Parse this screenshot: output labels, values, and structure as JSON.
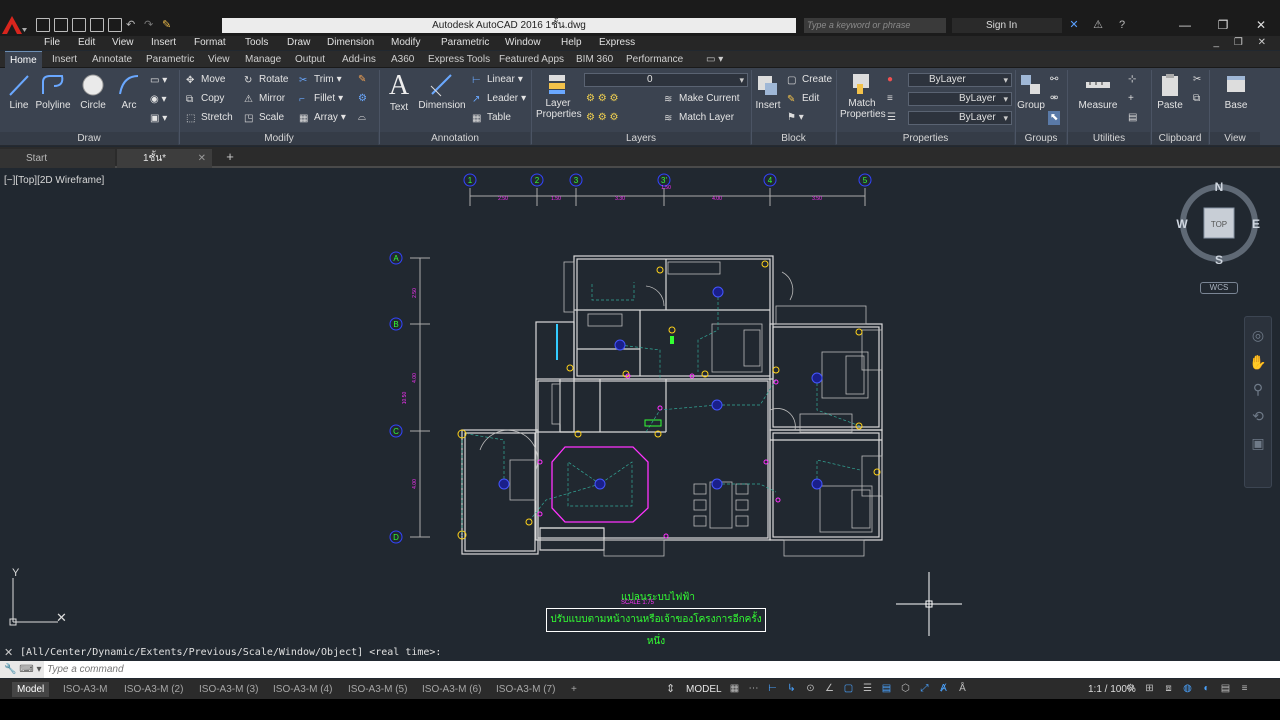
{
  "titlebar": {
    "title": "Autodesk AutoCAD 2016    1ชั้น.dwg",
    "search_placeholder": "Type a keyword or phrase",
    "signin_label": "Sign In",
    "logo_color": "#d8251d"
  },
  "menu": [
    "File",
    "Edit",
    "View",
    "Insert",
    "Format",
    "Tools",
    "Draw",
    "Dimension",
    "Modify",
    "Parametric",
    "Window",
    "Help",
    "Express"
  ],
  "ribbon_tabs": [
    "Home",
    "Insert",
    "Annotate",
    "Parametric",
    "View",
    "Manage",
    "Output",
    "Add-ins",
    "A360",
    "Express Tools",
    "Featured Apps",
    "BIM 360",
    "Performance"
  ],
  "ribbon": {
    "draw": {
      "title": "Draw",
      "line": "Line",
      "polyline": "Polyline",
      "circle": "Circle",
      "arc": "Arc"
    },
    "modify": {
      "title": "Modify",
      "move": "Move",
      "rotate": "Rotate",
      "trim": "Trim",
      "copy": "Copy",
      "mirror": "Mirror",
      "fillet": "Fillet",
      "stretch": "Stretch",
      "scale": "Scale",
      "array": "Array"
    },
    "annotation": {
      "title": "Annotation",
      "text": "Text",
      "dimension": "Dimension",
      "linear": "Linear",
      "leader": "Leader",
      "table": "Table"
    },
    "layers": {
      "title": "Layers",
      "layer_properties_1": "Layer",
      "layer_properties_2": "Properties",
      "current_layer": "0",
      "make_current": "Make Current",
      "match_layer": "Match Layer"
    },
    "block": {
      "title": "Block",
      "insert": "Insert",
      "create": "Create",
      "edit": "Edit"
    },
    "properties": {
      "title": "Properties",
      "match_1": "Match",
      "match_2": "Properties",
      "color": "ByLayer",
      "linetype": "ByLayer",
      "lineweight": "ByLayer"
    },
    "groups": {
      "title": "Groups",
      "group": "Group"
    },
    "utilities": {
      "title": "Utilities",
      "measure": "Measure"
    },
    "clipboard": {
      "title": "Clipboard",
      "paste": "Paste"
    },
    "view": {
      "title": "View",
      "base": "Base"
    }
  },
  "doc_tabs": {
    "start": "Start",
    "file": "1ชั้น*"
  },
  "viewport": {
    "label": "[−][Top][2D Wireframe]"
  },
  "viewcube": {
    "n": "N",
    "s": "S",
    "e": "E",
    "w": "W",
    "top": "TOP",
    "wcs": "WCS"
  },
  "drawing": {
    "grid_top": [
      "1",
      "2",
      "3",
      "3'",
      "4",
      "5"
    ],
    "dims_top": [
      "2.50",
      "1.50",
      "3.30",
      "1.50",
      "4.00",
      "3.50"
    ],
    "grid_left": [
      "A",
      "B",
      "C",
      "D"
    ],
    "dims_left": [
      "2.50",
      "4.00",
      "10.50",
      "4.00"
    ],
    "plan_title": "แปลนระบบไฟฟ้า",
    "plan_scale": "SCALE          1:75",
    "plan_note": "ปรับแบบตามหน้างานหรือเจ้าของโครงการอีกครั้งหนึ่ง",
    "colors": {
      "walls": "#d9d9d9",
      "magenta": "#ff33ff",
      "green": "#33ff33",
      "yellow": "#ffd21a",
      "blue": "#3344ff",
      "cyan": "#33ccff",
      "wire": "#33aa99"
    }
  },
  "command": {
    "history": "[All/Center/Dynamic/Extents/Previous/Scale/Window/Object] <real time>:",
    "placeholder": "Type a command"
  },
  "layout_tabs": [
    "Model",
    "ISO-A3-M",
    "ISO-A3-M (2)",
    "ISO-A3-M (3)",
    "ISO-A3-M (4)",
    "ISO-A3-M (5)",
    "ISO-A3-M (6)",
    "ISO-A3-M (7)"
  ],
  "status": {
    "model": "MODEL",
    "scale": "1:1 / 100%"
  }
}
